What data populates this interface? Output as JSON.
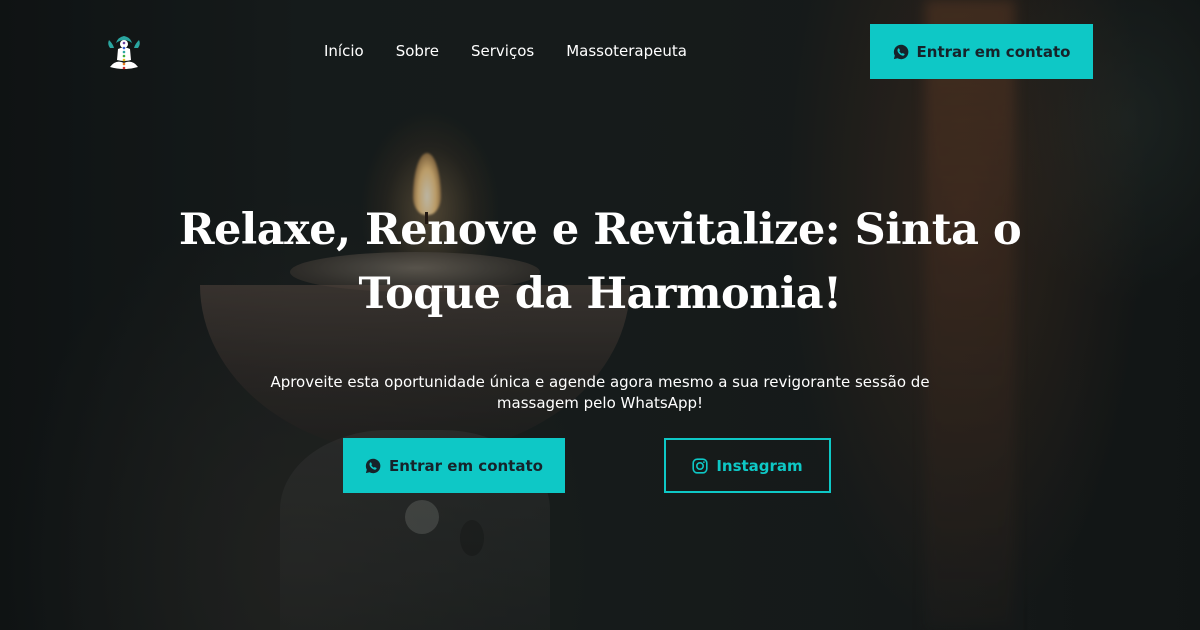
{
  "brand": {
    "logo_icon": "meditation-chakra-icon",
    "accent_color": "#0ec8c6"
  },
  "nav": {
    "items": [
      {
        "label": "Início"
      },
      {
        "label": "Sobre"
      },
      {
        "label": "Serviços"
      },
      {
        "label": "Massoterapeuta"
      }
    ]
  },
  "header": {
    "cta_label": "Entrar em contato",
    "cta_icon": "whatsapp-icon"
  },
  "hero": {
    "title": "Relaxe, Renove e Revitalize: Sinta o Toque da Harmonia!",
    "subtitle": "Aproveite esta oportunidade única e agende agora mesmo a sua revigorante sessão de massagem pelo WhatsApp!",
    "primary_cta_label": "Entrar em contato",
    "primary_cta_icon": "whatsapp-icon",
    "secondary_cta_label": "Instagram",
    "secondary_cta_icon": "instagram-icon"
  }
}
